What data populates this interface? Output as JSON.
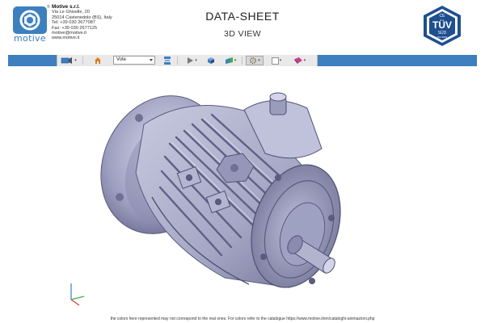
{
  "company": {
    "logo_text": "motive",
    "registered": "®",
    "name": "Motive s.r.l.",
    "address": "Via Le Ghiselle, 20",
    "city": "25014 Castenedolo (BS), Italy",
    "tel": "Tel: +39 030 2677087",
    "fax": "Fax: +39 030 2677125",
    "email": "motive@motive.it",
    "web": "www.motive.it"
  },
  "header": {
    "title": "DATA-SHEET",
    "subtitle": "3D VIEW"
  },
  "certification": {
    "top_text": "CE",
    "brand": "TÜV",
    "sub": "SÜD",
    "tiny": "ISO 9001"
  },
  "toolbar": {
    "view_select_value": "Vote",
    "buttons": [
      "camera-icon",
      "home-icon",
      "view-select",
      "explode-icon",
      "play-icon",
      "cube-icon",
      "section-icon",
      "settings-icon",
      "checkbox-icon",
      "measure-icon"
    ]
  },
  "viewer": {
    "model": "electric motor 3D model",
    "colors": {
      "body": "#a8a9c6",
      "body_dark": "#6f7094",
      "body_light": "#d4d5e8",
      "accent": "#3d7fbf"
    }
  },
  "footer": {
    "disclaimer": "the colors here represented may not correspond to the real ones. For colors refer to the catalogue https://www.motive.it/en/cataloghi-animazioni.php"
  }
}
